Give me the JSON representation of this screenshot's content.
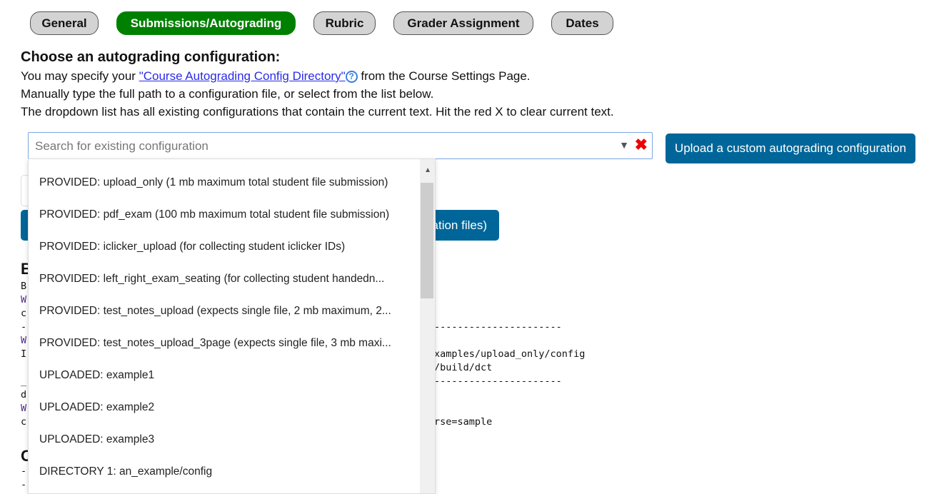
{
  "tabs": [
    {
      "label": "General"
    },
    {
      "label": "Submissions/Autograding",
      "active": true
    },
    {
      "label": "Rubric"
    },
    {
      "label": "Grader Assignment"
    },
    {
      "label": "Dates"
    }
  ],
  "heading": "Choose an autograding configuration:",
  "intro": {
    "prefix": "You may specify your ",
    "link": "\"Course Autograding Config Directory\"",
    "help_icon": "?",
    "suffix": " from the Course Settings Page.",
    "line2": "Manually type the full path to a configuration file, or select from the list below.",
    "line3": "The dropdown list has all existing configurations that contain the current text. Hit the red X to clear current text."
  },
  "search": {
    "placeholder": "Search for existing configuration",
    "value": "",
    "caret": "▼",
    "clear": "✖"
  },
  "upload_button": "Upload a custom autograding configuration",
  "hidden_button_fragment": "ation files)",
  "dropdown": {
    "items": [
      "PROVIDED: upload_only (1 mb maximum total student file submission)",
      "PROVIDED: pdf_exam (100 mb maximum total student file submission)",
      "PROVIDED: iclicker_upload (for collecting student iclicker IDs)",
      "PROVIDED: left_right_exam_seating (for collecting student handedn...",
      "PROVIDED: test_notes_upload (expects single file, 2 mb maximum, 2...",
      "PROVIDED: test_notes_upload_3page (expects single file, 3 mb maxi...",
      "UPLOADED: example1",
      "UPLOADED: example2",
      "UPLOADED: example3",
      "DIRECTORY 1: an_example/config"
    ],
    "scroll_position": 0
  },
  "background": {
    "heading1": "B",
    "heading2": "C",
    "left": [
      "B",
      "W",
      "c",
      "-",
      "W",
      "I",
      "",
      "_",
      "d",
      "W",
      "c"
    ],
    "right": [
      "",
      "",
      "",
      "----------------------",
      "",
      "xamples/upload_only/config",
      "/build/dct",
      "----------------------",
      "",
      "",
      "rse=sample"
    ],
    "bottom": [
      "-",
      "-"
    ]
  }
}
